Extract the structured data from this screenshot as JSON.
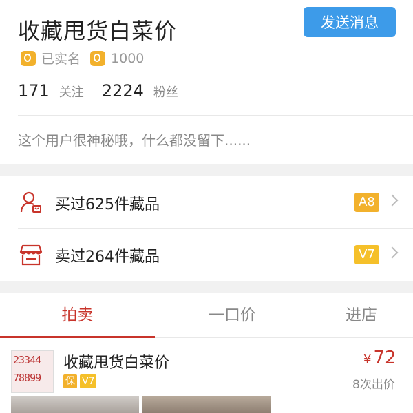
{
  "profile": {
    "username": "收藏甩货白菜价",
    "send_message_label": "发送消息",
    "verified_label": "已实名",
    "credit_score": "1000",
    "following_count": "171",
    "following_label": "关注",
    "followers_count": "2224",
    "followers_label": "粉丝",
    "bio": "这个用户很神秘哦，什么都没留下......"
  },
  "records": [
    {
      "label": "买过625件藏品",
      "level": "A8",
      "level_color": "#f2b12c"
    },
    {
      "label": "卖过264件藏品",
      "level": "V7",
      "level_color": "#f5c02a"
    }
  ],
  "tabs": [
    {
      "label": "拍卖",
      "active": true
    },
    {
      "label": "一口价",
      "active": false
    },
    {
      "label": "进店",
      "active": false
    }
  ],
  "listing": {
    "title": "收藏甩货白菜价",
    "tags": [
      "保",
      "V7"
    ],
    "currency": "¥",
    "price": "72",
    "bids": "8次出价",
    "thumb_text_top": "23344",
    "thumb_text_bottom": "78899"
  },
  "colors": {
    "accent_red": "#c8342b",
    "button_blue": "#3d9be9",
    "badge_gold": "#f2b12c"
  },
  "icons": {
    "verified": "id-badge-icon",
    "credit": "credit-badge-icon",
    "buy": "buyer-user-icon",
    "sell": "shop-store-icon",
    "chevron": "chevron-right-icon"
  }
}
